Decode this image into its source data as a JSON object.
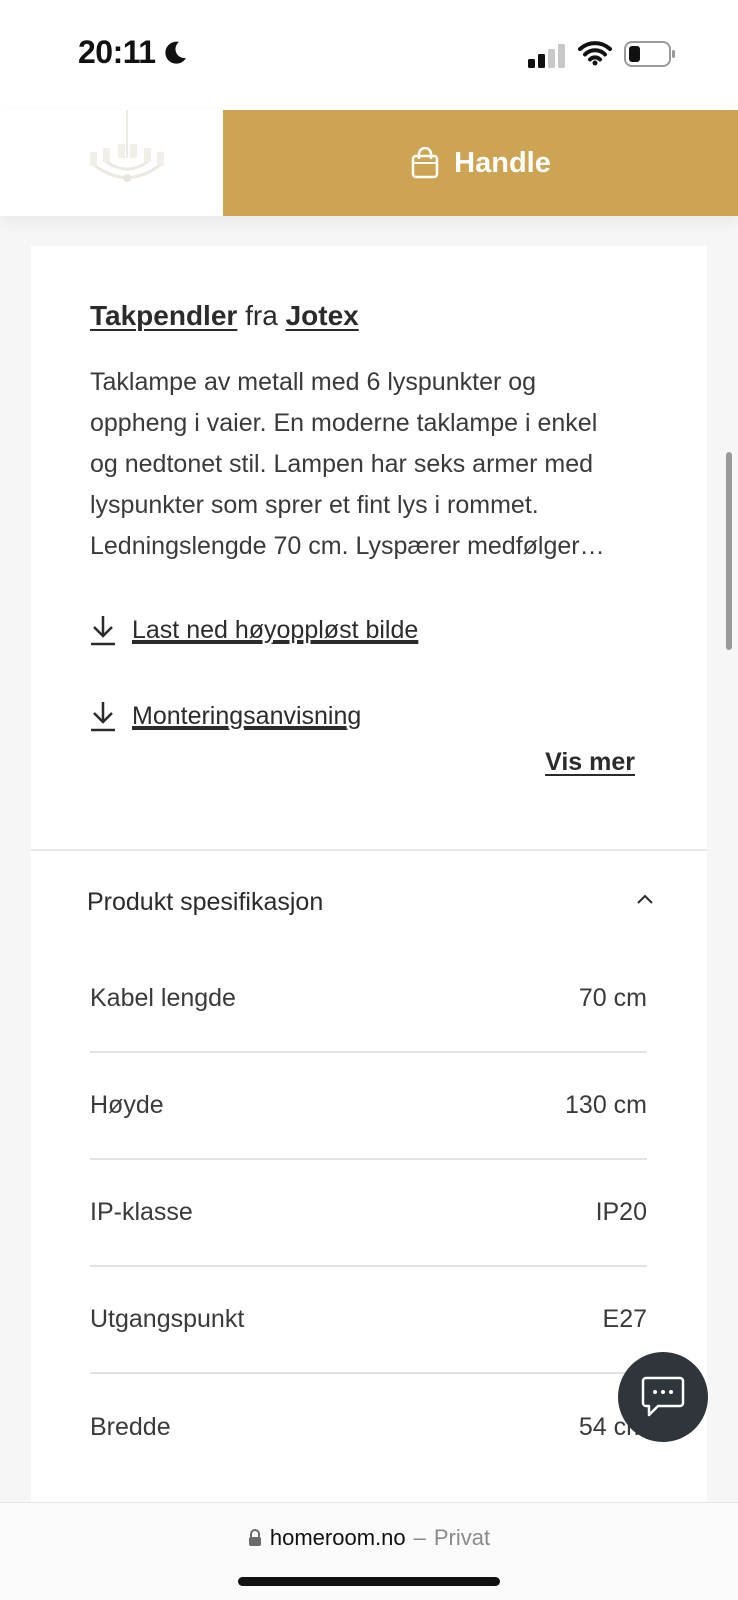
{
  "status_bar": {
    "time": "20:11",
    "icons": [
      "moon-icon",
      "cellular-signal-icon",
      "wifi-icon",
      "battery-icon"
    ]
  },
  "header": {
    "thumbnail_icon": "chandelier-thumbnail",
    "shop_button_label": "Handle",
    "shop_icon": "shopping-bag-icon",
    "accent_color": "#cda453"
  },
  "product": {
    "category_link": "Takpendler",
    "fra": "fra",
    "brand_link": "Jotex",
    "description_lines": [
      "Taklampe av metall med 6 lyspunkter og",
      "oppheng i vaier. En moderne taklampe i enkel",
      "og nedtonet stil. Lampen har seks armer med",
      "lyspunkter som sprer et fint lys i rommet.",
      "Ledningslengde 70 cm. Lyspærer medfølger…"
    ],
    "downloads": [
      {
        "label": "Last ned høyoppløst bilde",
        "icon": "download-icon"
      },
      {
        "label": "Monteringsanvisning",
        "icon": "download-icon"
      }
    ],
    "show_more": "Vis mer"
  },
  "specs": {
    "title": "Produkt spesifikasjon",
    "expanded": true,
    "rows": [
      {
        "label": "Kabel lengde",
        "value": "70 cm"
      },
      {
        "label": "Høyde",
        "value": "130 cm"
      },
      {
        "label": "IP-klasse",
        "value": "IP20"
      },
      {
        "label": "Utgangspunkt",
        "value": "E27"
      },
      {
        "label": "Bredde",
        "value": "54 cm"
      }
    ]
  },
  "chat": {
    "icon": "chat-bubble-icon"
  },
  "url_bar": {
    "domain": "homeroom.no",
    "separator": "–",
    "mode": "Privat",
    "lock_icon": "lock-icon"
  }
}
